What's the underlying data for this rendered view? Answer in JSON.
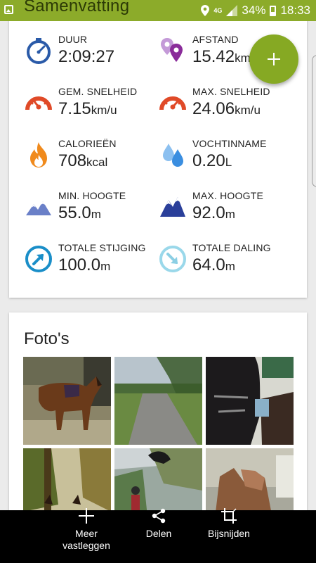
{
  "status_bar": {
    "title": "Samenvatting",
    "network": "4G",
    "battery": "34%",
    "time": "18:33"
  },
  "stats": [
    {
      "id": "duration",
      "label": "DUUR",
      "value": "2:09:27",
      "unit": "",
      "icon": "stopwatch-icon"
    },
    {
      "id": "distance",
      "label": "AFSTAND",
      "value": "15.42",
      "unit": "km",
      "icon": "map-pins-icon"
    },
    {
      "id": "avg-speed",
      "label": "GEM. SNELHEID",
      "value": "7.15",
      "unit": "km/u",
      "icon": "speedometer-icon"
    },
    {
      "id": "max-speed",
      "label": "MAX. SNELHEID",
      "value": "24.06",
      "unit": "km/u",
      "icon": "speedometer-max-icon"
    },
    {
      "id": "calories",
      "label": "CALORIEËN",
      "value": "708",
      "unit": "kcal",
      "icon": "flame-icon"
    },
    {
      "id": "fluid",
      "label": "VOCHTINNAME",
      "value": "0.20",
      "unit": "L",
      "icon": "water-drops-icon"
    },
    {
      "id": "min-altitude",
      "label": "MIN. HOOGTE",
      "value": "55.0",
      "unit": "m",
      "icon": "mountain-low-icon"
    },
    {
      "id": "max-altitude",
      "label": "MAX. HOOGTE",
      "value": "92.0",
      "unit": "m",
      "icon": "mountain-high-icon"
    },
    {
      "id": "total-ascent",
      "label": "TOTALE STIJGING",
      "value": "100.0",
      "unit": "m",
      "icon": "ascent-arrow-icon"
    },
    {
      "id": "total-descent",
      "label": "TOTALE DALING",
      "value": "64.0",
      "unit": "m",
      "icon": "descent-arrow-icon"
    }
  ],
  "fab": {
    "icon": "plus-icon"
  },
  "photos": {
    "title": "Foto's"
  },
  "bottom_bar": {
    "capture_line1": "Meer",
    "capture_line2": "vastleggen",
    "share": "Delen",
    "crop": "Bijsnijden"
  },
  "colors": {
    "accent_green": "#86a923",
    "status_bar": "#8cab2a",
    "icon_blue": "#2a5aa8",
    "icon_purple": "#8a4ca0",
    "icon_red": "#e04a28",
    "icon_orange": "#f08a1c",
    "icon_lightblue": "#3a8ee0",
    "icon_teal": "#1a8ec8"
  }
}
